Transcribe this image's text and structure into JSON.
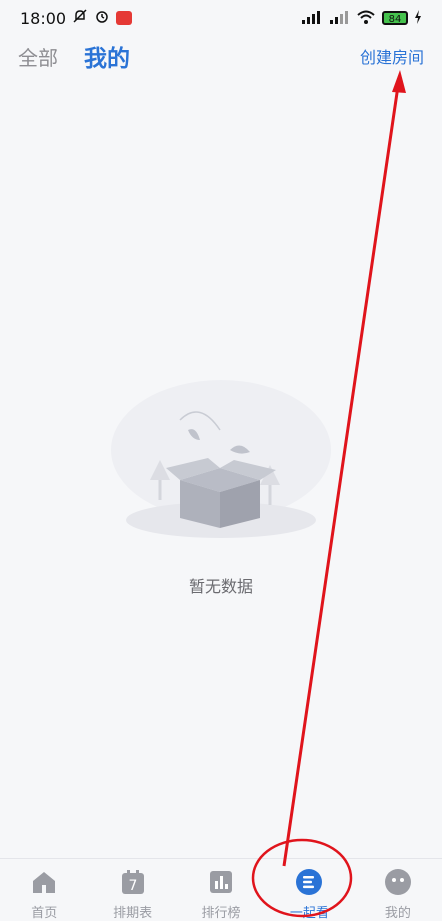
{
  "status": {
    "time": "18:00",
    "battery": "84"
  },
  "header": {
    "tab_all": "全部",
    "tab_mine": "我的",
    "create_room": "创建房间"
  },
  "empty": {
    "text": "暂无数据"
  },
  "tabbar": {
    "items": [
      {
        "label": "首页"
      },
      {
        "label": "排期表",
        "icon_text": "7"
      },
      {
        "label": "排行榜"
      },
      {
        "label": "一起看"
      },
      {
        "label": "我的"
      }
    ]
  },
  "colors": {
    "accent": "#2a73d6",
    "annotation": "#e0141c"
  }
}
